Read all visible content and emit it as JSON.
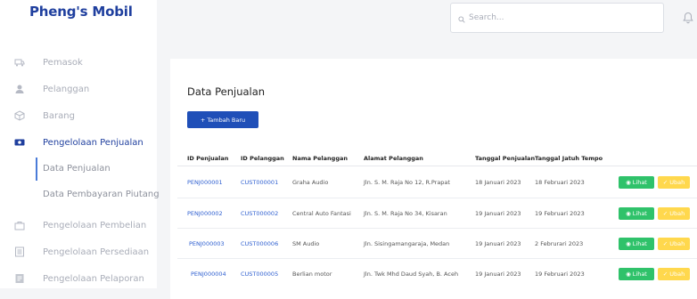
{
  "brand": "Pheng's Mobil",
  "search": {
    "placeholder": "Search..."
  },
  "sidebar": {
    "items": [
      {
        "label": "Pemasok",
        "icon": "truck-icon"
      },
      {
        "label": "Pelanggan",
        "icon": "user-icon"
      },
      {
        "label": "Barang",
        "icon": "box-icon"
      },
      {
        "label": "Pengelolaan Penjualan",
        "icon": "cash-icon",
        "active": true
      },
      {
        "label": "Pengelolaan Pembelian",
        "icon": "bag-icon"
      },
      {
        "label": "Pengelolaan Persediaan",
        "icon": "inventory-icon"
      },
      {
        "label": "Pengelolaan Pelaporan",
        "icon": "report-icon"
      }
    ],
    "sub_items": [
      "Data Penjualan",
      "Data Pembayaran Piutang"
    ]
  },
  "main": {
    "title": "Data Penjualan",
    "add_button": "+ Tambah Baru",
    "columns": [
      "ID Penjualan",
      "ID Pelanggan",
      "Nama Pelanggan",
      "Alamat Pelanggan",
      "Tanggal Penjualan",
      "Tanggal Jatuh Tempo"
    ],
    "rows": [
      [
        "PENJ000001",
        "CUST000001",
        "Graha Audio",
        "Jln. S. M. Raja No 12, R.Prapat",
        "18 Januari 2023",
        "18 Februari 2023"
      ],
      [
        "PENJ000002",
        "CUST000002",
        "Central Auto Fantasi",
        "Jln. S. M. Raja No 34, Kisaran",
        "19 Januari 2023",
        "19 Februari 2023"
      ],
      [
        "PENJ000003",
        "CUST000006",
        "SM Audio",
        "Jln. Sisingamangaraja, Medan",
        "19 Januari 2023",
        "2 Februrari 2023"
      ],
      [
        "PENJ000004",
        "CUST000005",
        "Berlian motor",
        "Jln. Twk Mhd Daud Syah, B. Aceh",
        "19 Januari 2023",
        "19 Februari 2023"
      ]
    ],
    "view_label": "Lihat",
    "edit_label": "Ubah"
  },
  "colors": {
    "brand": "#1f3f9e",
    "primary": "#1f4fb8",
    "view": "#2fc26a",
    "edit": "#ffd84d",
    "link": "#2e5fd0"
  }
}
